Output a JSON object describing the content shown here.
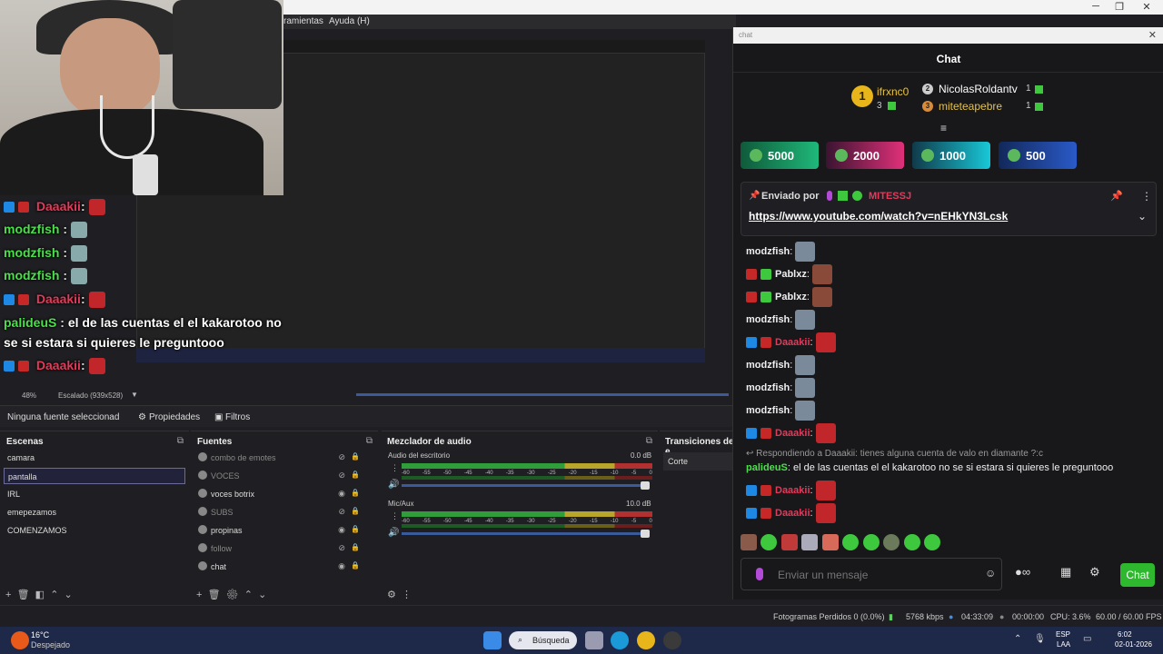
{
  "obs": {
    "menu": [
      "ramientas",
      "Ayuda (H)"
    ],
    "scale_text": "48%",
    "scale_mode": "Escalado (939x528)",
    "source_toolbar": {
      "no_source": "Ninguna fuente seleccionad",
      "properties": "Propiedades",
      "filters": "Filtros"
    },
    "docks": {
      "scenes_title": "Escenas",
      "sources_title": "Fuentes",
      "mixer_title": "Mezclador de audio",
      "transitions_title": "Transiciones de e"
    },
    "scenes": [
      "camara",
      "pantalla",
      "IRL",
      "emepezamos",
      "COMENZAMOS"
    ],
    "active_scene_index": 1,
    "sources": [
      {
        "name": "combo de emotes",
        "visible": false
      },
      {
        "name": "VOCES",
        "visible": false
      },
      {
        "name": "voces botrix",
        "visible": true
      },
      {
        "name": "SUBS",
        "visible": false
      },
      {
        "name": "propinas",
        "visible": true
      },
      {
        "name": "follow",
        "visible": false
      },
      {
        "name": "chat",
        "visible": true
      }
    ],
    "mixer": [
      {
        "name": "Audio del escritorio",
        "db": "0.0 dB",
        "level": 0.9
      },
      {
        "name": "Mic/Aux",
        "db": "10.0 dB",
        "level": 0.9
      }
    ],
    "mixer_scale": [
      "-60",
      "-55",
      "-50",
      "-45",
      "-40",
      "-35",
      "-30",
      "-25",
      "-20",
      "-15",
      "-10",
      "-5",
      "0"
    ],
    "transition": "Corte",
    "status": {
      "dropped": "Fotogramas Perdidos 0 (0.0%)",
      "bitrate": "5768 kbps",
      "live_time": "04:33:09",
      "rec_time": "00:00:00",
      "cpu": "CPU: 3.6%",
      "fps": "60.00 / 60.00 FPS"
    }
  },
  "overlay_chat": [
    {
      "user": "Daaakii",
      "sep": ":",
      "text": "",
      "color": "#e23a5a"
    },
    {
      "user": "modzfish",
      "sep": " :",
      "text": "",
      "color": "#4be04b"
    },
    {
      "user": "modzfish",
      "sep": " :",
      "text": "",
      "color": "#4be04b"
    },
    {
      "user": "modzfish",
      "sep": " :",
      "text": "",
      "color": "#4be04b"
    },
    {
      "user": "Daaakii",
      "sep": ":",
      "text": "",
      "color": "#e23a5a"
    },
    {
      "user": "palideuS",
      "sep": " :",
      "text": "el de las cuentas el el kakarotoo no",
      "color": "#4be04b"
    },
    {
      "user": "",
      "sep": "",
      "text": "se si estara si quieres le preguntooo",
      "color": "#ffffff"
    },
    {
      "user": "Daaakii",
      "sep": ":",
      "text": "",
      "color": "#e23a5a"
    }
  ],
  "chat": {
    "window_title": "chat",
    "header": "Chat",
    "leaderboard": [
      {
        "rank": "1",
        "name": "ifrxnc0",
        "count": "3"
      },
      {
        "rank": "2",
        "name": "NicolasRoldantv",
        "count": "1"
      },
      {
        "rank": "3",
        "name": "miteteарebre",
        "count": "1"
      }
    ],
    "bits": [
      "5000",
      "2000",
      "1000",
      "500"
    ],
    "pinned": {
      "label": "Enviado por",
      "sender": "MITESSJ",
      "link": "https://www.youtube.com/watch?v=nEHkYN3Lcsk"
    },
    "messages": [
      {
        "user": "modzfish",
        "color": "#ffffff",
        "text": ""
      },
      {
        "user": "Pablxz",
        "color": "#ffffff",
        "text": ""
      },
      {
        "user": "Pablxz",
        "color": "#ffffff",
        "text": ""
      },
      {
        "user": "modzfish",
        "color": "#ffffff",
        "text": ""
      },
      {
        "user": "Daaakii",
        "color": "#e23a5a",
        "text": ""
      },
      {
        "user": "modzfish",
        "color": "#ffffff",
        "text": ""
      },
      {
        "user": "modzfish",
        "color": "#ffffff",
        "text": ""
      },
      {
        "user": "modzfish",
        "color": "#ffffff",
        "text": ""
      },
      {
        "user": "Daaakii",
        "color": "#e23a5a",
        "text": ""
      }
    ],
    "reply_context": "Respondiendo a Daaakii: tienes alguna cuenta de valo en diamante ?:c",
    "reply": {
      "user": "palideuS",
      "text": "el de las cuentas el el kakarotoo no se si estara si quieres le preguntooo"
    },
    "after_reply": [
      {
        "user": "Daaakii",
        "color": "#e23a5a"
      },
      {
        "user": "Daaakii",
        "color": "#e23a5a"
      }
    ],
    "input_placeholder": "Enviar un mensaje",
    "send_label": "Chat"
  },
  "taskbar": {
    "weather_temp": "16°C",
    "weather_desc": "Despejado",
    "search": "Búsqueda",
    "lang": "ESP",
    "lang2": "LAA",
    "time": "6:02",
    "date": "02-01-2026"
  },
  "colors": {
    "accent_green": "#2db82d",
    "chat_bg": "#18181b",
    "obs_bg": "#1f1f23",
    "taskbar": "#1e2848"
  }
}
